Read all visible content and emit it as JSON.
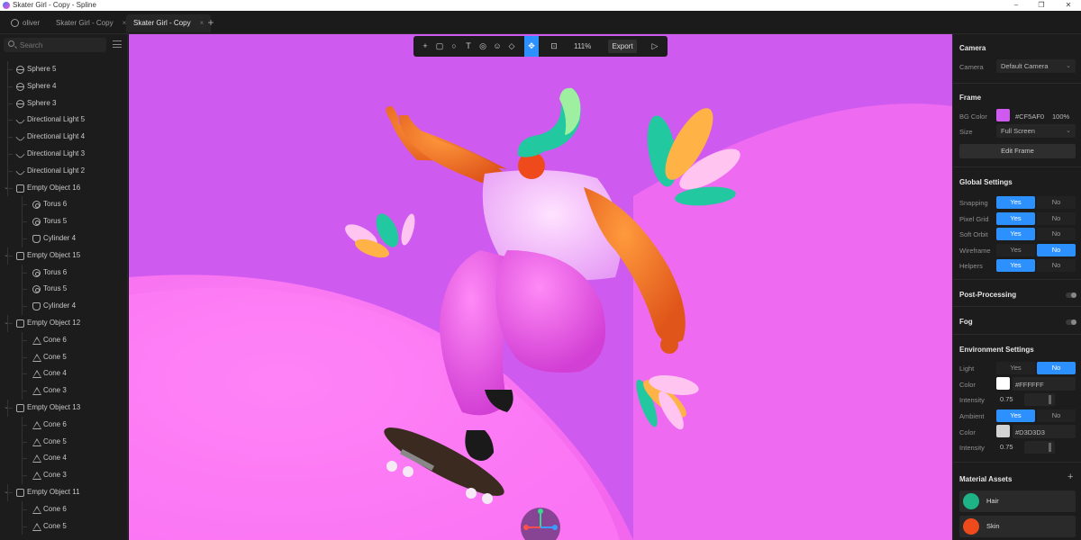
{
  "window": {
    "title": "Skater Girl - Copy - Spline",
    "min": "–",
    "max": "❐",
    "close": "✕"
  },
  "tabs": [
    {
      "label": "oliver"
    },
    {
      "label": "Skater Girl - Copy",
      "close": "×"
    },
    {
      "label": "Skater Girl - Copy",
      "close": "×"
    }
  ],
  "new_tab": "+",
  "search": {
    "placeholder": "Search"
  },
  "layers": [
    {
      "label": "Sphere 5",
      "icon": "sphere"
    },
    {
      "label": "Sphere 4",
      "icon": "sphere"
    },
    {
      "label": "Sphere 3",
      "icon": "sphere"
    },
    {
      "label": "Directional Light 5",
      "icon": "light"
    },
    {
      "label": "Directional Light 4",
      "icon": "light"
    },
    {
      "label": "Directional Light 3",
      "icon": "light"
    },
    {
      "label": "Directional Light 2",
      "icon": "light"
    },
    {
      "label": "Empty Object 16",
      "icon": "empty",
      "group": true
    },
    {
      "label": "Torus 6",
      "icon": "torus",
      "child": true
    },
    {
      "label": "Torus 5",
      "icon": "torus",
      "child": true
    },
    {
      "label": "Cylinder 4",
      "icon": "cylinder",
      "child": true
    },
    {
      "label": "Empty Object 15",
      "icon": "empty",
      "group": true
    },
    {
      "label": "Torus 6",
      "icon": "torus",
      "child": true
    },
    {
      "label": "Torus 5",
      "icon": "torus",
      "child": true
    },
    {
      "label": "Cylinder 4",
      "icon": "cylinder",
      "child": true
    },
    {
      "label": "Empty Object 12",
      "icon": "empty",
      "group": true
    },
    {
      "label": "Cone 6",
      "icon": "cone",
      "child": true
    },
    {
      "label": "Cone 5",
      "icon": "cone",
      "child": true
    },
    {
      "label": "Cone 4",
      "icon": "cone",
      "child": true
    },
    {
      "label": "Cone 3",
      "icon": "cone",
      "child": true
    },
    {
      "label": "Empty Object 13",
      "icon": "empty",
      "group": true
    },
    {
      "label": "Cone 6",
      "icon": "cone",
      "child": true
    },
    {
      "label": "Cone 5",
      "icon": "cone",
      "child": true
    },
    {
      "label": "Cone 4",
      "icon": "cone",
      "child": true
    },
    {
      "label": "Cone 3",
      "icon": "cone",
      "child": true
    },
    {
      "label": "Empty Object 11",
      "icon": "empty",
      "group": true
    },
    {
      "label": "Cone 6",
      "icon": "cone",
      "child": true
    },
    {
      "label": "Cone 5",
      "icon": "cone",
      "child": true
    }
  ],
  "toolbar": {
    "tools": [
      "plus-icon",
      "rectangle-icon",
      "circle-icon",
      "text-icon",
      "sphere-tool-icon",
      "smiley-icon",
      "paint-bucket-icon",
      "move-icon",
      "frame-icon"
    ],
    "zoom": "111%",
    "export": "Export",
    "play": "play-icon"
  },
  "viewport": {
    "bg": "#CF5AF0"
  },
  "right": {
    "camera": {
      "title": "Camera",
      "label": "Camera",
      "value": "Default Camera"
    },
    "frame": {
      "title": "Frame",
      "bg_label": "BG Color",
      "bg_hex": "#CF5AF0",
      "bg_pct": "100%",
      "bg_color": "#cf5af0",
      "size_label": "Size",
      "size_value": "Full Screen",
      "edit": "Edit Frame"
    },
    "global": {
      "title": "Global Settings",
      "rows": [
        {
          "label": "Snapping",
          "yes": "Yes",
          "no": "No",
          "value": "Yes"
        },
        {
          "label": "Pixel Grid",
          "yes": "Yes",
          "no": "No",
          "value": "Yes"
        },
        {
          "label": "Soft Orbit",
          "yes": "Yes",
          "no": "No",
          "value": "Yes"
        },
        {
          "label": "Wireframe",
          "yes": "Yes",
          "no": "No",
          "value": "No"
        },
        {
          "label": "Helpers",
          "yes": "Yes",
          "no": "No",
          "value": "Yes"
        }
      ]
    },
    "post": {
      "title": "Post-Processing"
    },
    "fog": {
      "title": "Fog"
    },
    "env": {
      "title": "Environment Settings",
      "light_label": "Light",
      "light_yes": "Yes",
      "light_no": "No",
      "light_value": "No",
      "color1_label": "Color",
      "color1_hex": "#FFFFFF",
      "color1": "#ffffff",
      "int1_label": "Intensity",
      "int1_value": "0.75",
      "ambient_label": "Ambient",
      "ambient_yes": "Yes",
      "ambient_no": "No",
      "ambient_value": "Yes",
      "color2_label": "Color",
      "color2_hex": "#D3D3D3",
      "color2": "#d3d3d3",
      "int2_label": "Intensity",
      "int2_value": "0.75"
    },
    "assets": {
      "title": "Material Assets",
      "add": "+",
      "items": [
        {
          "name": "Hair",
          "color": "#1db386"
        },
        {
          "name": "Skin",
          "color": "#ef4a1c"
        }
      ]
    }
  }
}
